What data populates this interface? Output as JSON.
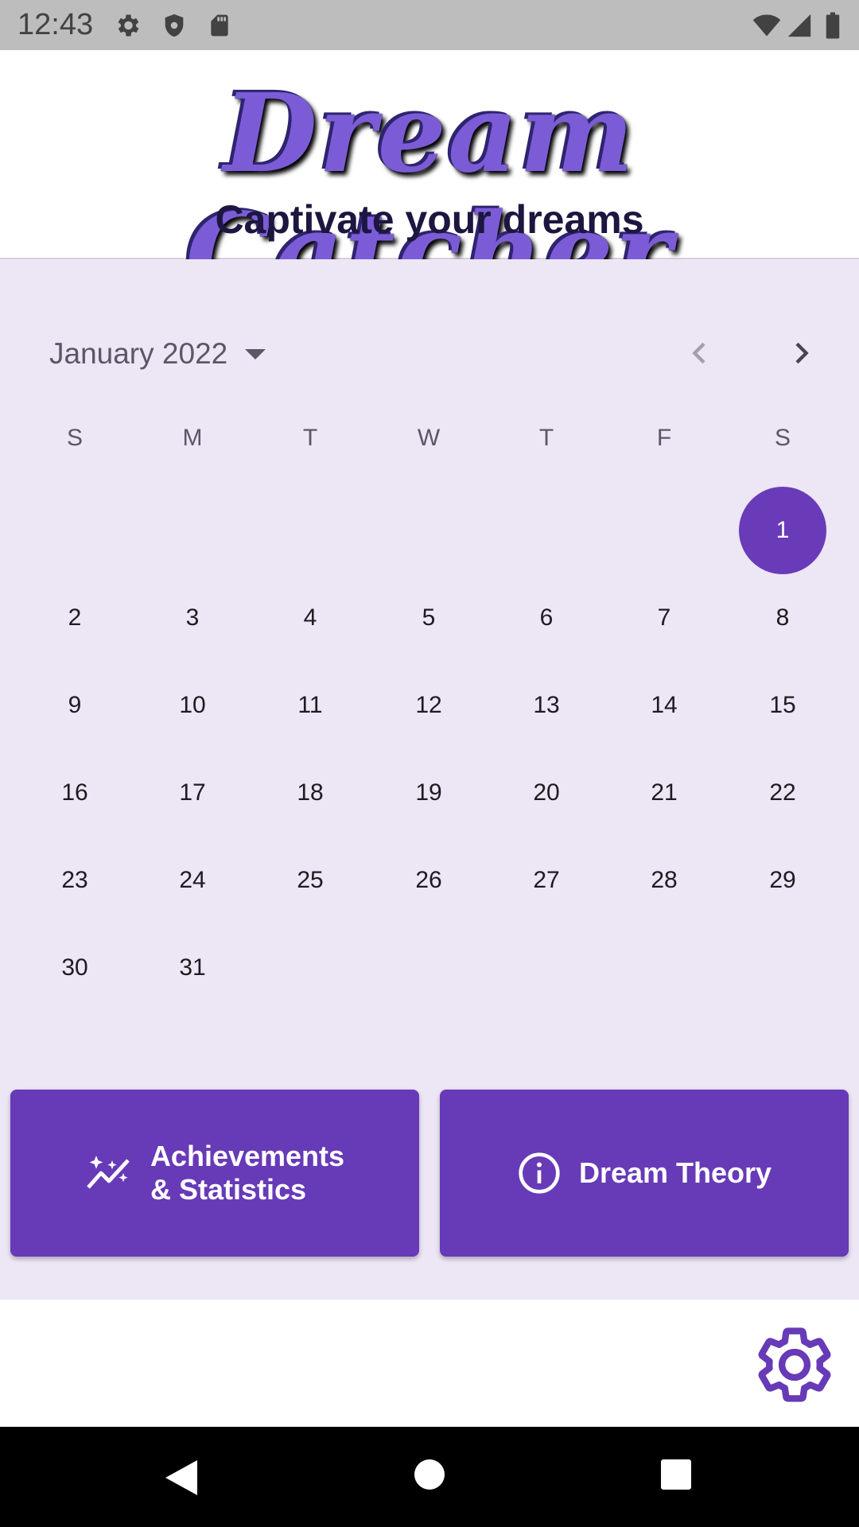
{
  "status_bar": {
    "time": "12:43",
    "icons": [
      "settings-icon",
      "shield-icon",
      "sd-card-icon",
      "wifi-icon",
      "signal-icon",
      "battery-icon"
    ]
  },
  "header": {
    "title": "Dream Catcher",
    "subtitle": "Captivate your dreams"
  },
  "calendar": {
    "month_label": "January 2022",
    "weekdays": [
      "S",
      "M",
      "T",
      "W",
      "T",
      "F",
      "S"
    ],
    "days": [
      "1",
      "2",
      "3",
      "4",
      "5",
      "6",
      "7",
      "8",
      "9",
      "10",
      "11",
      "12",
      "13",
      "14",
      "15",
      "16",
      "17",
      "18",
      "19",
      "20",
      "21",
      "22",
      "23",
      "24",
      "25",
      "26",
      "27",
      "28",
      "29",
      "30",
      "31"
    ],
    "selected_day": "1",
    "first_weekday_index": 6
  },
  "buttons": {
    "achievements_line1": "Achievements",
    "achievements_line2": "& Statistics",
    "achievements_icon": "auto-graph-icon",
    "theory_label": "Dream Theory",
    "theory_icon": "info-icon"
  },
  "colors": {
    "accent": "#673ab7",
    "panel_bg": "#ece6f5",
    "title": "#7b5cd6"
  }
}
